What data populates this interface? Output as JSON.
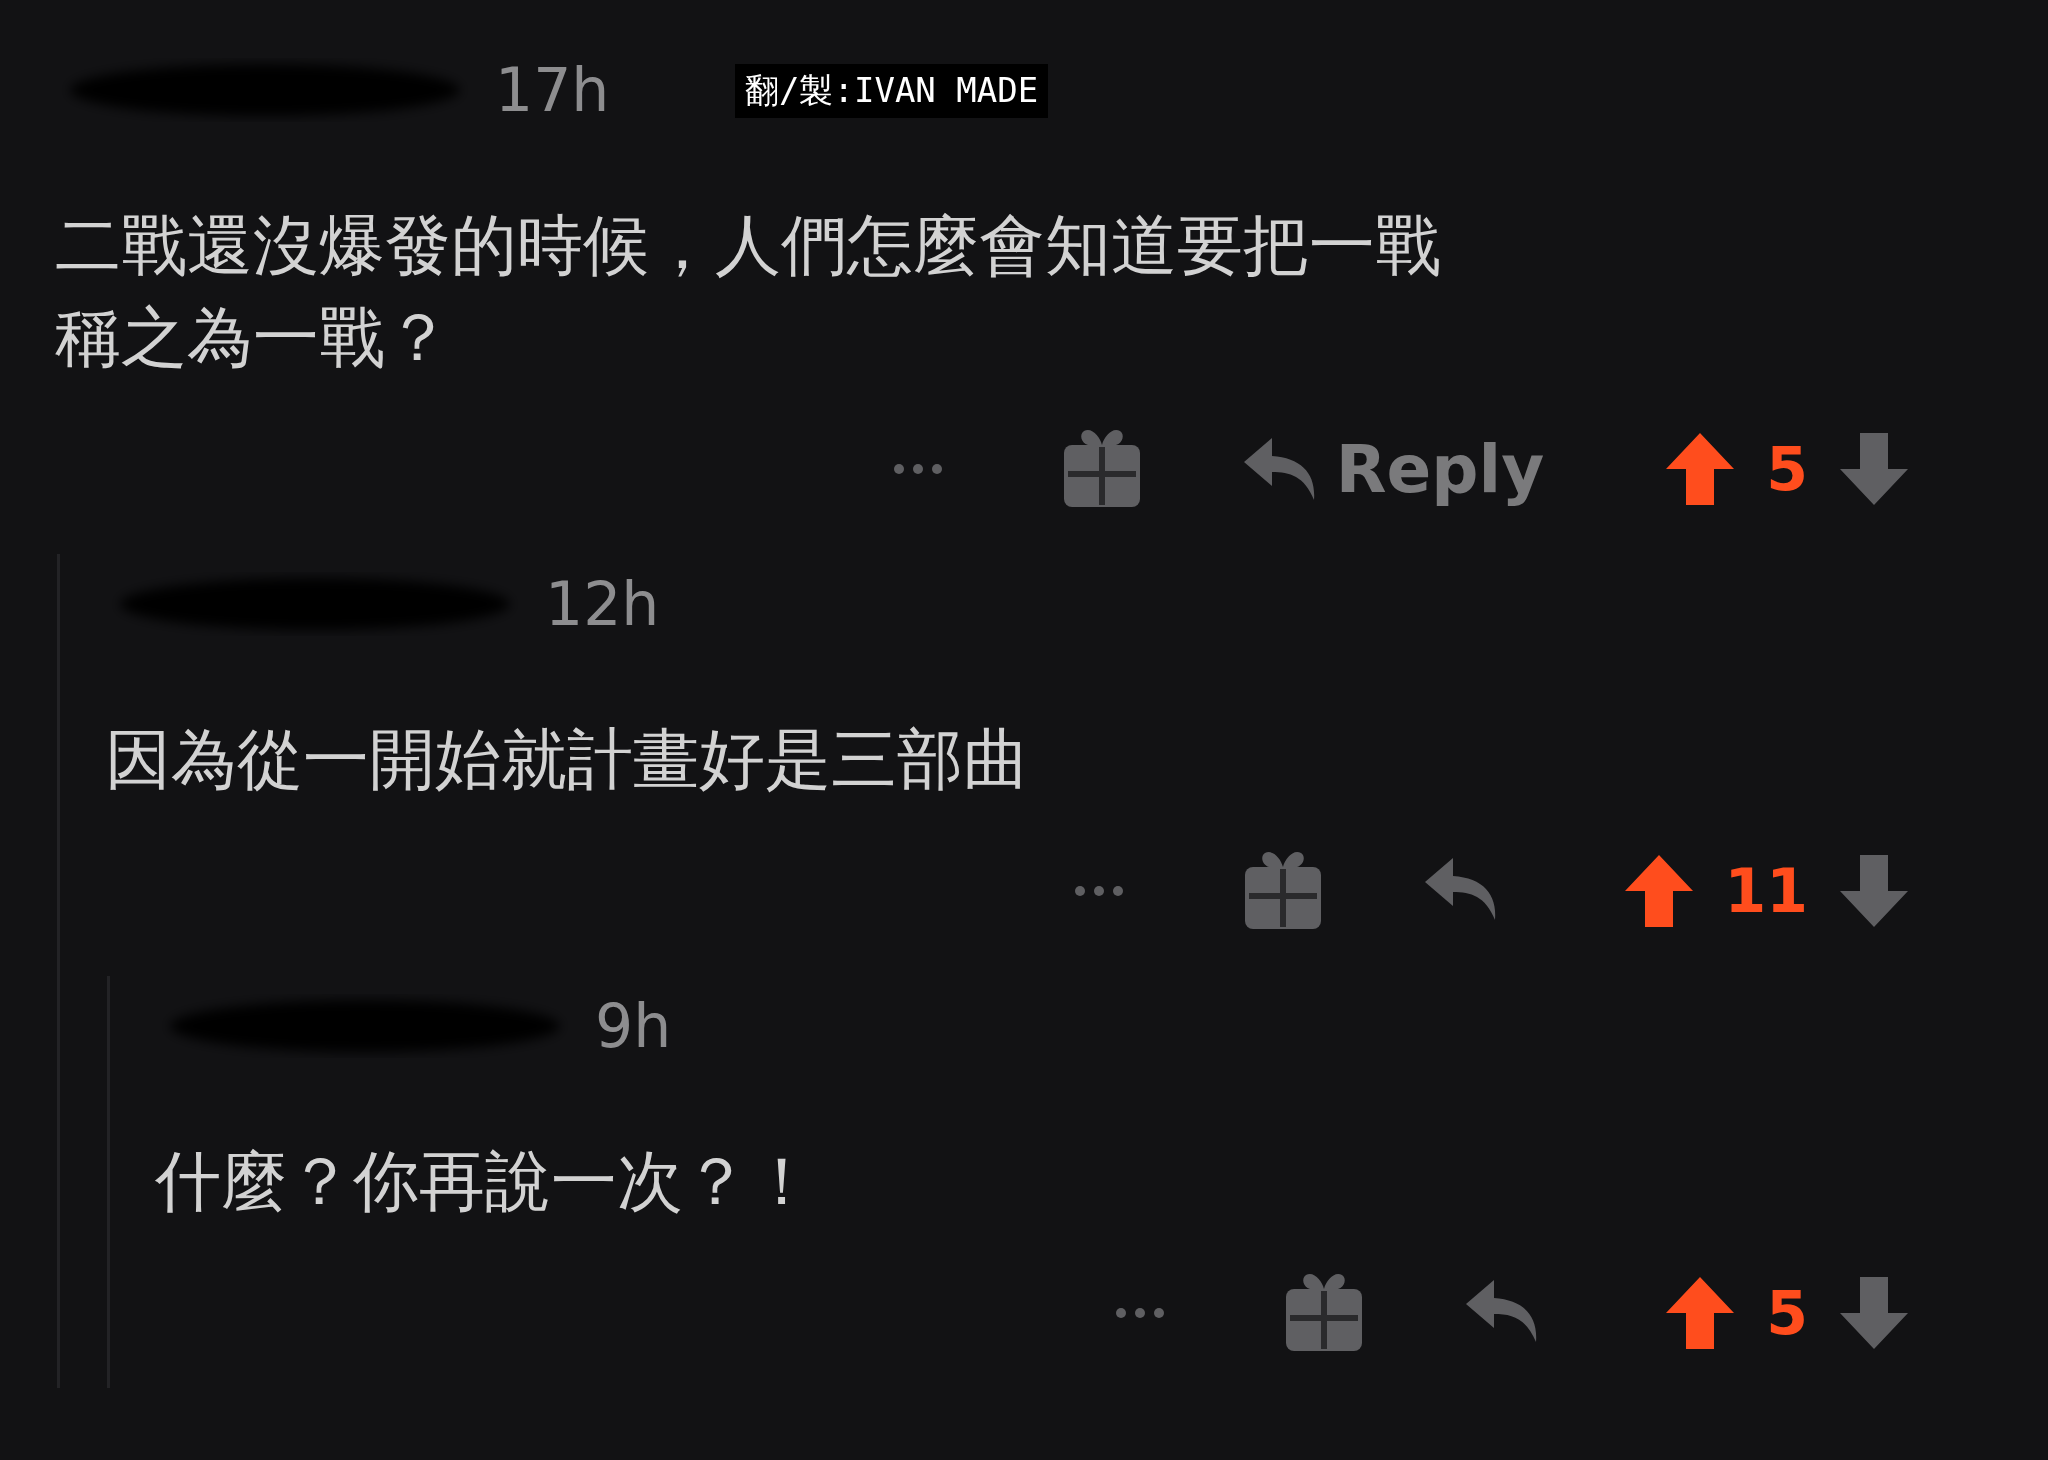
{
  "credit": "翻/製:IVAN MADE",
  "comments": [
    {
      "time": "17h",
      "body_lines": [
        "二戰還沒爆發的時候，人們怎麼會知道要把一戰",
        "稱之為一戰？"
      ],
      "reply_label": "Reply",
      "score": "5",
      "upvoted": true,
      "replies": [
        {
          "time": "12h",
          "body_lines": [
            "因為從一開始就計畫好是三部曲"
          ],
          "score": "11",
          "upvoted": true,
          "replies": [
            {
              "time": "9h",
              "body_lines": [
                "什麼？你再說一次？！"
              ],
              "score": "5",
              "upvoted": true
            }
          ]
        }
      ]
    }
  ]
}
